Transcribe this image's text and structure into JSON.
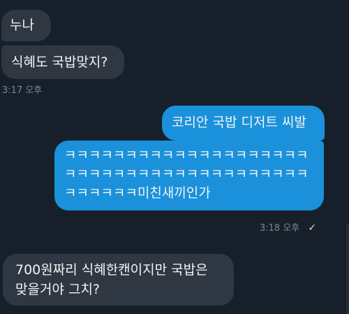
{
  "messages": [
    {
      "text": "누나"
    },
    {
      "text": "식혜도 국밥맞지?"
    },
    {
      "text": "코리안 국밥 디저트 씨발"
    },
    {
      "text": "ㅋㅋㅋㅋㅋㅋㅋㅋㅋㅋㅋㅋㅋㅋㅋㅋㅋㅋㅋㅋ\nㅋㅋㅋㅋㅋㅋㅋㅋㅋㅋㅋㅋㅋㅋㅋㅋㅋㅋㅋㅋ\nㅋㅋㅋㅋㅋㅋ미친새끼인가"
    },
    {
      "text": "700원짜리 식혜한캔이지만 국밥은\n맞을거야 그치?"
    }
  ],
  "timestamps": [
    {
      "text": "3:17 오후"
    },
    {
      "text": "3:18 오후"
    }
  ],
  "icons": {
    "read_receipt": "✓"
  },
  "colors": {
    "background": "#17202a",
    "incoming_bubble": "#2f3842",
    "outgoing_bubble": "#1a91da",
    "timestamp": "#7d8792"
  }
}
